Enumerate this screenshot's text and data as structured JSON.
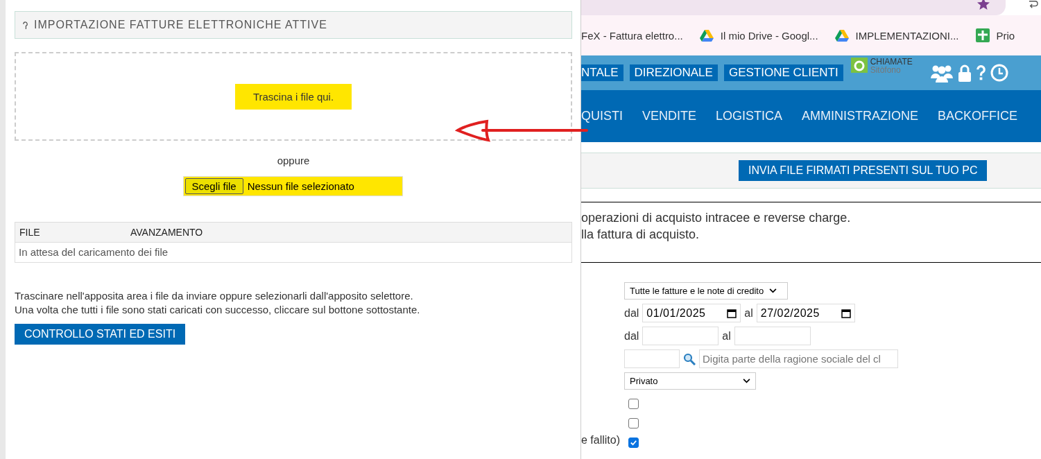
{
  "browser": {
    "bookmarks": [
      {
        "kind": "plain",
        "label": "FeX - Fattura elettro..."
      },
      {
        "kind": "drive",
        "label": "Il mio Drive - Googl..."
      },
      {
        "kind": "drive",
        "label": "IMPLEMENTAZIONI..."
      },
      {
        "kind": "sheet",
        "label": "Prio"
      }
    ]
  },
  "top_menu": [
    "NTALE",
    "DIREZIONALE",
    "GESTIONE CLIENTI"
  ],
  "logo": {
    "line1": "CHIAMATE",
    "line2": "Sitòfono"
  },
  "main_nav": [
    "QUISTI",
    "VENDITE",
    "LOGISTICA",
    "AMMINISTRAZIONE",
    "BACKOFFICE"
  ],
  "action_button": "INVIA FILE FIRMATI PRESENTI SUL TUO PC",
  "notes": [
    "operazioni di acquisto intracee e reverse charge.",
    "lla fattura di acquisto."
  ],
  "filters": {
    "type_select": "Tutte le fatture e le note di credito",
    "date_from_label": "dal",
    "date_from": "01/01/2025",
    "date_to_label": "al",
    "date_to": "27/02/2025",
    "num_from_label": "dal",
    "num_to_label": "al",
    "customer_placeholder": "Digita parte della ragione sociale del cl",
    "kind_select": "Privato",
    "checkboxes": [
      {
        "checked": false
      },
      {
        "checked": false
      },
      {
        "label": "e fallito)",
        "checked": true
      }
    ]
  },
  "dialog": {
    "title": "IMPORTAZIONE FATTURE ELETTRONICHE ATTIVE",
    "drop_zone": {
      "text": "Trascina i file qui.",
      "highlighted": true
    },
    "or": "oppure",
    "file_input": {
      "button": "Scegli file",
      "status": "Nessun file selezionato",
      "highlighted": true
    },
    "table": {
      "columns": [
        "FILE",
        "AVANZAMENTO"
      ],
      "empty_message": "In attesa del caricamento dei file"
    },
    "instructions": [
      "Trascinare nell'apposita area i file da inviare oppure selezionarli dall'apposito selettore.",
      "Una volta che tutti i file sono stati caricati con successo, cliccare sul bottone sottostante."
    ],
    "button": "CONTROLLO STATI ED ESITI"
  }
}
